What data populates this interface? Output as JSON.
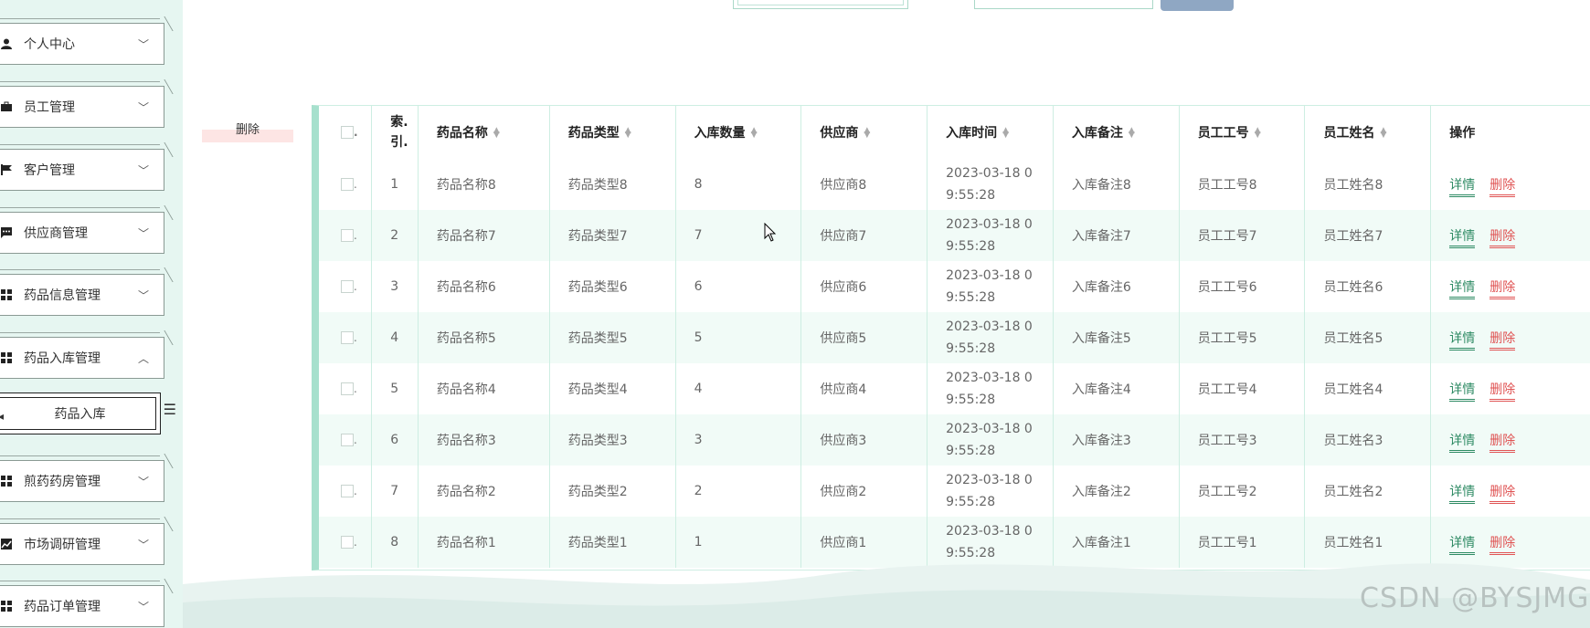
{
  "sidebar": {
    "items": [
      {
        "label": "个人中心",
        "icon": "person-icon",
        "chevron": "down"
      },
      {
        "label": "员工管理",
        "icon": "briefcase-icon",
        "chevron": "down"
      },
      {
        "label": "客户管理",
        "icon": "flag-icon",
        "chevron": "down"
      },
      {
        "label": "供应商管理",
        "icon": "chat-icon",
        "chevron": "down"
      },
      {
        "label": "药品信息管理",
        "icon": "grid-icon",
        "chevron": "down"
      },
      {
        "label": "药品入库管理",
        "icon": "grid-icon",
        "chevron": "up"
      },
      {
        "label": "煎药药房管理",
        "icon": "grid-icon",
        "chevron": "down"
      },
      {
        "label": "市场调研管理",
        "icon": "chart-icon",
        "chevron": "down"
      },
      {
        "label": "药品订单管理",
        "icon": "grid-icon",
        "chevron": "down"
      }
    ],
    "submenu_label": "药品入库"
  },
  "toolbar": {
    "delete_label": "删除"
  },
  "table": {
    "headers": [
      "索.引.",
      "药品名称",
      "药品类型",
      "入库数量",
      "供应商",
      "入库时间",
      "入库备注",
      "员工工号",
      "员工姓名",
      "操作"
    ],
    "detail_label": "详情",
    "delete_label": "删除",
    "rows": [
      {
        "index": "1",
        "name": "药品名称8",
        "type": "药品类型8",
        "qty": "8",
        "supplier": "供应商8",
        "time1": "2023-03-18 0",
        "time2": "9:55:28",
        "note": "入库备注8",
        "emp_no": "员工工号8",
        "emp_name": "员工姓名8"
      },
      {
        "index": "2",
        "name": "药品名称7",
        "type": "药品类型7",
        "qty": "7",
        "supplier": "供应商7",
        "time1": "2023-03-18 0",
        "time2": "9:55:28",
        "note": "入库备注7",
        "emp_no": "员工工号7",
        "emp_name": "员工姓名7"
      },
      {
        "index": "3",
        "name": "药品名称6",
        "type": "药品类型6",
        "qty": "6",
        "supplier": "供应商6",
        "time1": "2023-03-18 0",
        "time2": "9:55:28",
        "note": "入库备注6",
        "emp_no": "员工工号6",
        "emp_name": "员工姓名6"
      },
      {
        "index": "4",
        "name": "药品名称5",
        "type": "药品类型5",
        "qty": "5",
        "supplier": "供应商5",
        "time1": "2023-03-18 0",
        "time2": "9:55:28",
        "note": "入库备注5",
        "emp_no": "员工工号5",
        "emp_name": "员工姓名5"
      },
      {
        "index": "5",
        "name": "药品名称4",
        "type": "药品类型4",
        "qty": "4",
        "supplier": "供应商4",
        "time1": "2023-03-18 0",
        "time2": "9:55:28",
        "note": "入库备注4",
        "emp_no": "员工工号4",
        "emp_name": "员工姓名4"
      },
      {
        "index": "6",
        "name": "药品名称3",
        "type": "药品类型3",
        "qty": "3",
        "supplier": "供应商3",
        "time1": "2023-03-18 0",
        "time2": "9:55:28",
        "note": "入库备注3",
        "emp_no": "员工工号3",
        "emp_name": "员工姓名3"
      },
      {
        "index": "7",
        "name": "药品名称2",
        "type": "药品类型2",
        "qty": "2",
        "supplier": "供应商2",
        "time1": "2023-03-18 0",
        "time2": "9:55:28",
        "note": "入库备注2",
        "emp_no": "员工工号2",
        "emp_name": "员工姓名2"
      },
      {
        "index": "8",
        "name": "药品名称1",
        "type": "药品类型1",
        "qty": "1",
        "supplier": "供应商1",
        "time1": "2023-03-18 0",
        "time2": "9:55:28",
        "note": "入库备注1",
        "emp_no": "员工工号1",
        "emp_name": "员工姓名1"
      }
    ]
  },
  "watermark": "CSDN @BYSJMG",
  "colors": {
    "sidebar_bg": "#e6f6f1",
    "accent": "#a7e0cd",
    "row_alt": "#f1fbf7",
    "detail": "#2d8a63",
    "delete": "#e05454"
  }
}
